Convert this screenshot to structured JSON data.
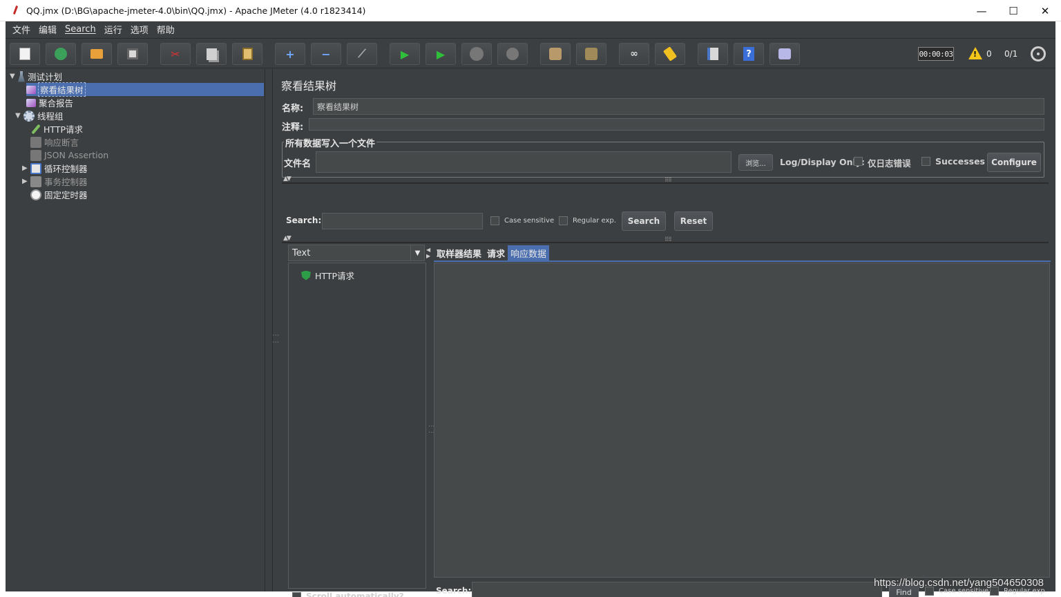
{
  "window": {
    "title": "QQ.jmx (D:\\BG\\apache-jmeter-4.0\\bin\\QQ.jmx) - Apache JMeter (4.0 r1823414)",
    "minimize": "—",
    "maximize": "☐",
    "close": "✕"
  },
  "menu": [
    "文件",
    "编辑",
    "Search",
    "运行",
    "选项",
    "帮助"
  ],
  "toolbar": {
    "timer": "00:00:03",
    "warning_count": "0",
    "threads": "0/1",
    "icons": [
      "new-icon",
      "templates-icon",
      "open-icon",
      "save-icon",
      "cut-icon",
      "copy-icon",
      "paste-icon",
      "expand-icon",
      "collapse-icon",
      "toggle-icon",
      "start-icon",
      "start-no-pause-icon",
      "stop-icon",
      "shutdown-icon",
      "clear-icon",
      "clear-all-icon",
      "search-icon",
      "reset-search-icon",
      "function-helper-icon",
      "help-icon",
      "remote-icon"
    ]
  },
  "tree": [
    {
      "label": "测试计划",
      "icon": "test-plan-icon"
    },
    {
      "label": "察看结果树",
      "icon": "listener-icon",
      "selected": true
    },
    {
      "label": "聚合报告",
      "icon": "listener-icon"
    },
    {
      "label": "线程组",
      "icon": "thread-group-icon"
    },
    {
      "label": "HTTP请求",
      "icon": "sampler-icon"
    },
    {
      "label": "响应断言",
      "icon": "assertion-icon",
      "disabled": true
    },
    {
      "label": "JSON Assertion",
      "icon": "assertion-icon",
      "disabled": true
    },
    {
      "label": "循环控制器",
      "icon": "controller-icon"
    },
    {
      "label": "事务控制器",
      "icon": "controller-icon",
      "disabled": true
    },
    {
      "label": "固定定时器",
      "icon": "timer-icon"
    }
  ],
  "panel": {
    "title": "察看结果树",
    "name_label": "名称:",
    "name_value": "察看结果树",
    "comment_label": "注释:",
    "comment_value": "",
    "file_group": "所有数据写入一个文件",
    "filename_label": "文件名",
    "filename_value": "",
    "browse": "浏览...",
    "log_display_only": "Log/Display Only:",
    "errors_only": "仅日志错误",
    "successes": "Successes",
    "configure": "Configure"
  },
  "search": {
    "label": "Search:",
    "value": "",
    "case_sensitive": "Case sensitive",
    "regular_exp": "Regular exp.",
    "search_btn": "Search",
    "reset_btn": "Reset"
  },
  "results": {
    "renderer": "Text",
    "items": [
      {
        "label": "HTTP请求",
        "status": "success"
      }
    ],
    "scroll_auto": "Scroll automatically?",
    "tabs": [
      "取样器结果",
      "请求",
      "响应数据"
    ],
    "active_tab": 2,
    "bottom_search_label": "Search:",
    "find_btn": "Find",
    "case_sensitive": "Case sensitive",
    "regular_exp": "Regular exp."
  },
  "watermark": "https://blog.csdn.net/yang504650308",
  "colors": {
    "bg": "#3c3f41",
    "selection": "#4b6eaf",
    "success": "#2e9d47",
    "warning": "#f5c518"
  }
}
